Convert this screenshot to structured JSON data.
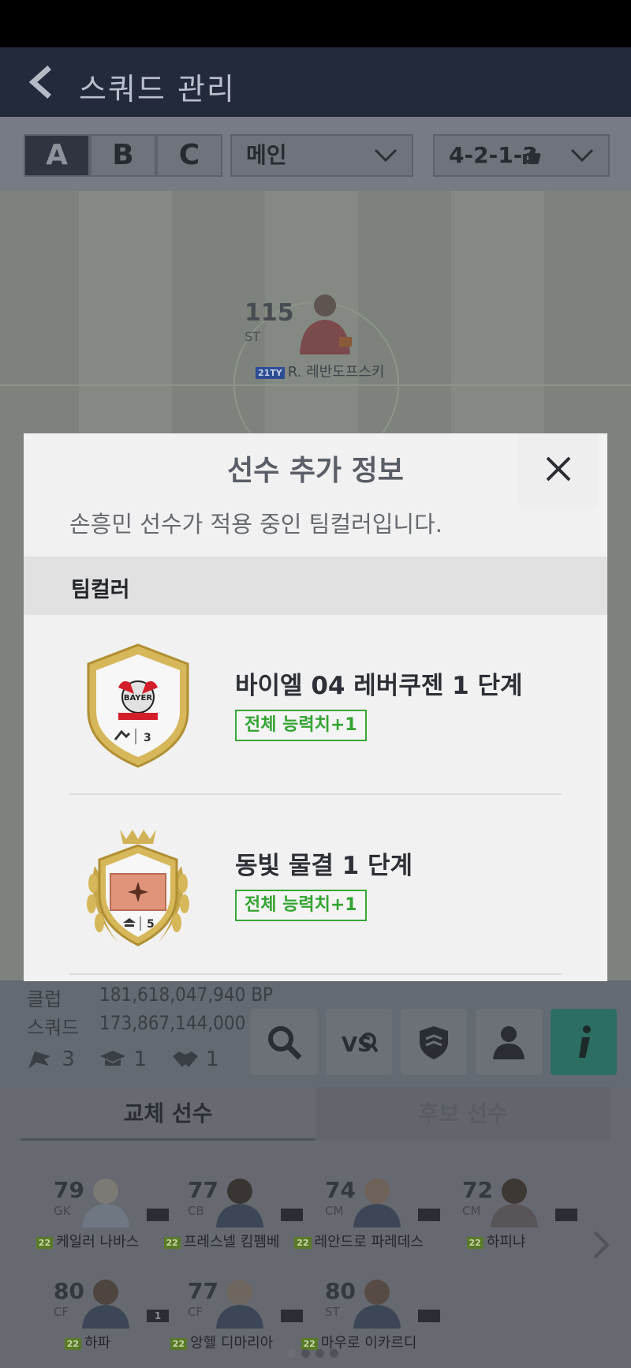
{
  "app": {
    "title": "스쿼드 관리"
  },
  "toolbar": {
    "squads": [
      "A",
      "B",
      "C"
    ],
    "active_squad": "A",
    "squad_select": "메인",
    "formation": "4-2-1-3"
  },
  "pitch": {
    "featured_player": {
      "ovr": "115",
      "position": "ST",
      "season": "21TY",
      "name": "R. 레반도프스키"
    }
  },
  "info": {
    "club_label": "클럽",
    "club_value": "181,618,047,940 BP",
    "squad_label": "스쿼드",
    "squad_value": "173,867,144,000 BP",
    "chem_flag_count": "3",
    "chem_cap_count": "1",
    "chem_hands_count": "1"
  },
  "actions": [
    "search-icon",
    "versus-icon",
    "shield-icon",
    "person-icon",
    "info-icon"
  ],
  "subs": {
    "tabs": [
      "교체 선수",
      "후보 선수"
    ],
    "players": [
      {
        "ovr": "79",
        "pos": "GK",
        "season": "22",
        "name": "케일러 나바스",
        "chip": ""
      },
      {
        "ovr": "77",
        "pos": "CB",
        "season": "22",
        "name": "프레스넬 킴펨베",
        "chip": ""
      },
      {
        "ovr": "74",
        "pos": "CM",
        "season": "22",
        "name": "레안드로 파레데스",
        "chip": ""
      },
      {
        "ovr": "72",
        "pos": "CM",
        "season": "22",
        "name": "하피냐",
        "chip": ""
      },
      {
        "ovr": "80",
        "pos": "CF",
        "season": "22",
        "name": "하파",
        "chip": "1"
      },
      {
        "ovr": "77",
        "pos": "CF",
        "season": "22",
        "name": "앙헬 디마리아",
        "chip": ""
      },
      {
        "ovr": "80",
        "pos": "ST",
        "season": "22",
        "name": "마우로 이카르디",
        "chip": ""
      }
    ]
  },
  "modal": {
    "title": "선수 추가 정보",
    "subtitle": "손흥민 선수가 적용 중인 팀컬러입니다.",
    "section": "팀컬러",
    "items": [
      {
        "name": "바이엘 04 레버쿠젠 1 단계",
        "effect": "전체 능력치+1",
        "badge_count": "3",
        "badge_type": "club-shield"
      },
      {
        "name": "동빛 물결 1 단계",
        "effect": "전체 능력치+1",
        "badge_count": "5",
        "badge_type": "laurel-crest"
      }
    ]
  },
  "colors": {
    "effect_green": "#34a432",
    "dim_overlay": "#222a3c",
    "info_button": "#2d6e63"
  }
}
